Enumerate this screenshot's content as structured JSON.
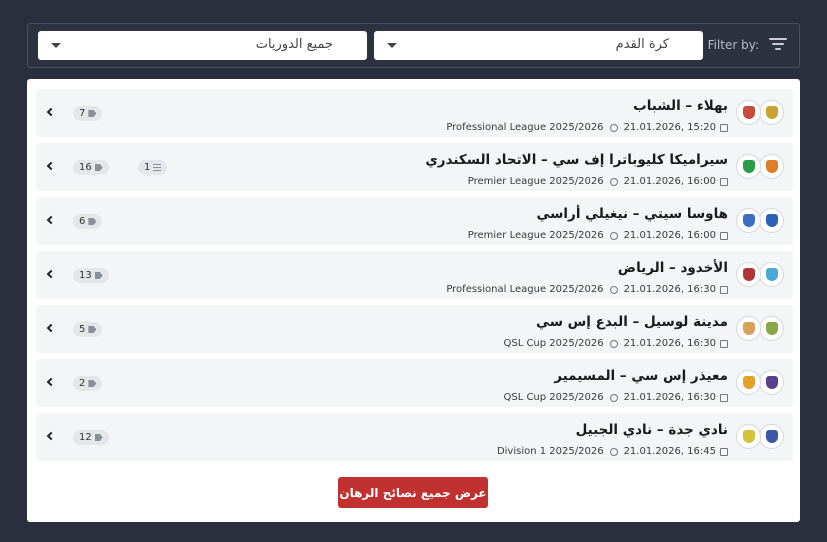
{
  "filter": {
    "label": "Filter by:",
    "sport_value": "كرة القدم",
    "league_value": "جميع الدوريات"
  },
  "matches": [
    {
      "title": "بهلاء – الشباب",
      "date": "21.01.2026, 15:20",
      "league": "Professional League 2025/2026",
      "tips": "7",
      "articles": "",
      "home_color": "#c8a233",
      "away_color": "#c94b3d"
    },
    {
      "title": "سيراميكا كليوباترا إف سي – الاتحاد السكندري",
      "date": "21.01.2026, 16:00",
      "league": "Premier League 2025/2026",
      "tips": "16",
      "articles": "1",
      "home_color": "#e07b2a",
      "away_color": "#2e9d4a"
    },
    {
      "title": "هاوسا سيتي – نيغيلي أراسي",
      "date": "21.01.2026, 16:00",
      "league": "Premier League 2025/2026",
      "tips": "6",
      "articles": "",
      "home_color": "#2b62b8",
      "away_color": "#3a6fc4"
    },
    {
      "title": "الأخدود – الرياض",
      "date": "21.01.2026, 16:30",
      "league": "Professional League 2025/2026",
      "tips": "13",
      "articles": "",
      "home_color": "#4aa8d8",
      "away_color": "#b2343b"
    },
    {
      "title": "مدينة لوسيل – البدع إس سي",
      "date": "21.01.2026, 16:30",
      "league": "QSL Cup 2025/2026",
      "tips": "5",
      "articles": "",
      "home_color": "#8aa84a",
      "away_color": "#d9a05a"
    },
    {
      "title": "معيذر إس سي – المسيمير",
      "date": "21.01.2026, 16:30",
      "league": "QSL Cup 2025/2026",
      "tips": "2",
      "articles": "",
      "home_color": "#5a3f8c",
      "away_color": "#e3a12a"
    },
    {
      "title": "نادي جدة – نادي الجبيل",
      "date": "21.01.2026, 16:45",
      "league": "Division 1 2025/2026",
      "tips": "12",
      "articles": "",
      "home_color": "#3a57a8",
      "away_color": "#d4c33a"
    }
  ],
  "cta": {
    "label": "عرض جميع نصائح الرهان"
  }
}
